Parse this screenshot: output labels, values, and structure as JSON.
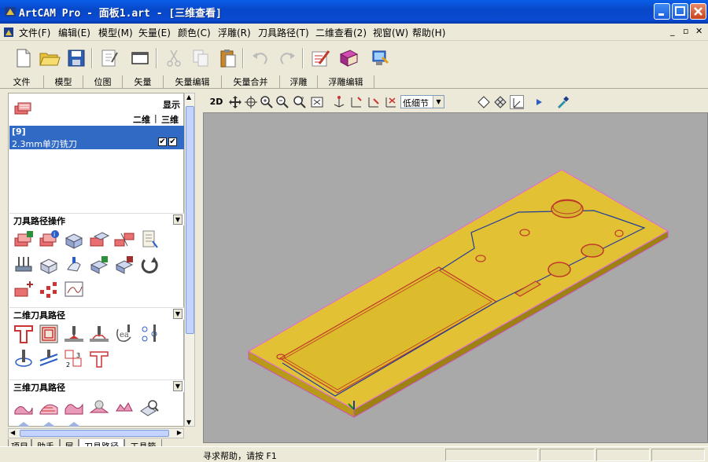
{
  "window": {
    "title": "ArtCAM Pro - 面板1.art - [三维查看]"
  },
  "menu": {
    "items": [
      "文件(F)",
      "编辑(E)",
      "模型(M)",
      "矢量(E)",
      "颜色(C)",
      "浮雕(R)",
      "刀具路径(T)",
      "二维查看(2)",
      "视窗(W)",
      "帮助(H)"
    ]
  },
  "toolbar_tabs": [
    "文件",
    "模型",
    "位图",
    "矢量",
    "矢量编辑",
    "矢量合并",
    "浮雕",
    "浮雕编辑"
  ],
  "left_panel": {
    "display_label": "显示",
    "col_2d": "二维",
    "col_3d": "三维",
    "tool_index": "[9]",
    "tool_name": "2.3mm单刃铣刀",
    "sections": {
      "toolpath_ops": "刀具路径操作",
      "toolpath_2d": "二维刀具路径",
      "toolpath_3d": "三维刀具路径"
    }
  },
  "bottom_tabs": [
    "项目",
    "助手",
    "层",
    "刀具路径",
    "工具箱"
  ],
  "view_toolbar": {
    "mode_2d": "2D",
    "detail_select": "低细节"
  },
  "status": {
    "help_text": "寻求帮助，请按 F1"
  }
}
